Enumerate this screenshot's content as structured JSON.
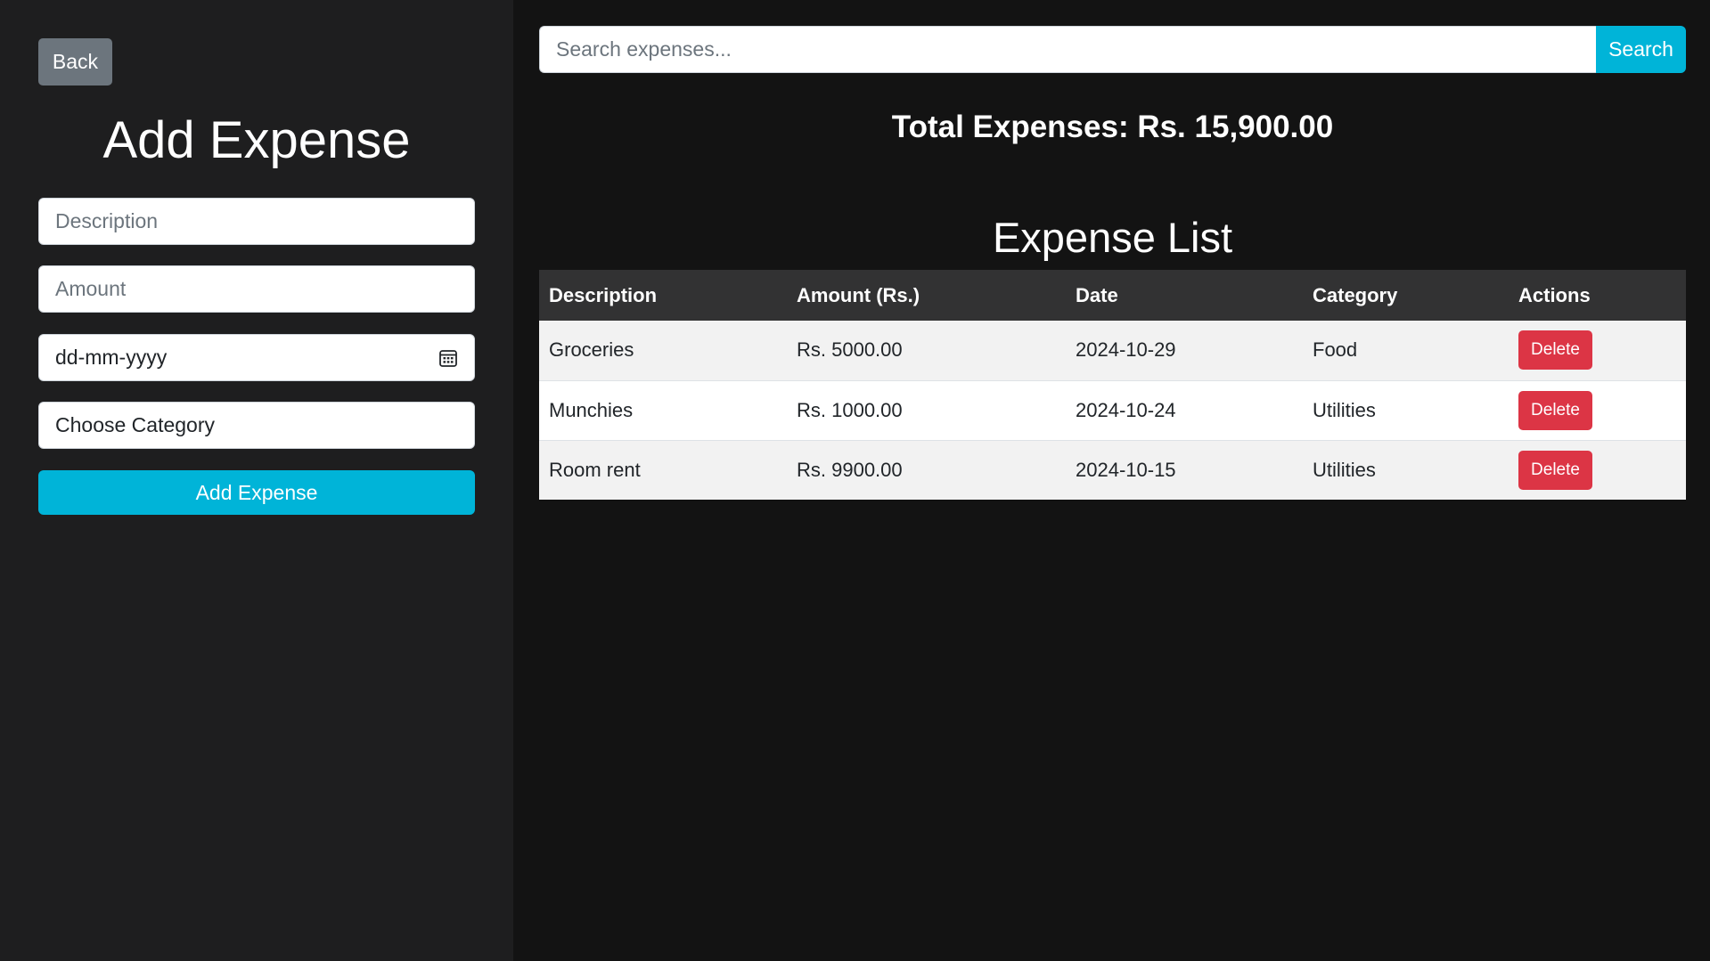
{
  "sidebar": {
    "back_label": "Back",
    "title": "Add Expense",
    "description_placeholder": "Description",
    "amount_placeholder": "Amount",
    "date_placeholder": "dd-mm-yyyy",
    "category_label": "Choose Category",
    "add_button_label": "Add Expense"
  },
  "main": {
    "search": {
      "placeholder": "Search expenses...",
      "button_label": "Search"
    },
    "total_expenses": "Total Expenses: Rs. 15,900.00",
    "list_title": "Expense List",
    "table": {
      "headers": [
        "Description",
        "Amount (Rs.)",
        "Date",
        "Category",
        "Actions"
      ],
      "rows": [
        {
          "description": "Groceries",
          "amount": "Rs. 5000.00",
          "date": "2024-10-29",
          "category": "Food",
          "action": "Delete"
        },
        {
          "description": "Munchies",
          "amount": "Rs. 1000.00",
          "date": "2024-10-24",
          "category": "Utilities",
          "action": "Delete"
        },
        {
          "description": "Room rent",
          "amount": "Rs. 9900.00",
          "date": "2024-10-15",
          "category": "Utilities",
          "action": "Delete"
        }
      ]
    }
  },
  "icons": {
    "date_picker": "calendar-icon"
  },
  "colors": {
    "sidebar_bg": "#1e1e1f",
    "main_bg": "#131313",
    "primary_button": "#00b4d8",
    "secondary_button": "#6c757d",
    "danger_button": "#dc3545",
    "table_header_bg": "#323233",
    "table_row_striped": "#f2f2f2",
    "table_row_plain": "#ffffff"
  }
}
